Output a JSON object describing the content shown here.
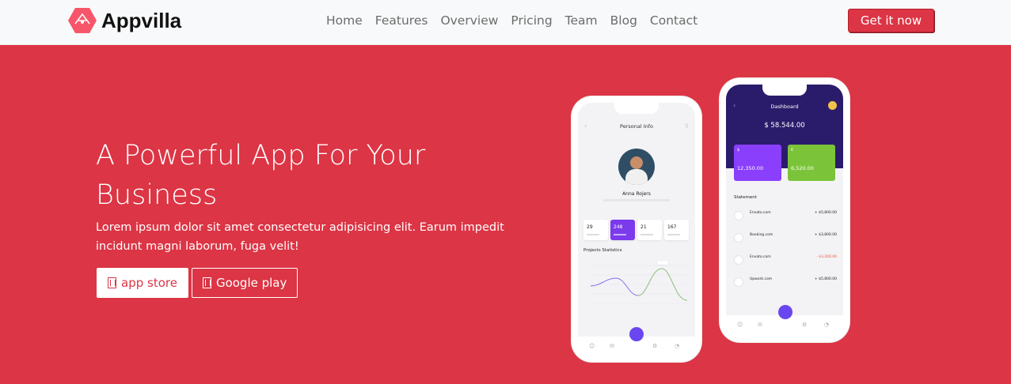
{
  "brand": {
    "name": "Appvilla",
    "logo_color": "#f7566a"
  },
  "nav": {
    "links": [
      "Home",
      "Features",
      "Overview",
      "Pricing",
      "Team",
      "Blog",
      "Contact"
    ],
    "cta": "Get it now"
  },
  "hero": {
    "title": "A Powerful App For Your Business",
    "text": "Lorem ipsum dolor sit amet consectetur adipisicing elit. Earum impedit incidunt magni laborum, fuga velit!",
    "buttons": [
      {
        "label": "app store",
        "icon": "app-store-glyph"
      },
      {
        "label": "Google play",
        "icon": "google-play-glyph"
      }
    ]
  },
  "phone_left": {
    "screen_title": "Personal Info",
    "user_name": "Anna Rojers",
    "stats": [
      {
        "value": "29"
      },
      {
        "value": "248"
      },
      {
        "value": "21"
      },
      {
        "value": "167"
      }
    ],
    "section_title": "Projects Statistics"
  },
  "phone_right": {
    "screen_title": "Dashboard",
    "balance": "$ 58.544.00",
    "cards": [
      {
        "symbol": "$",
        "amount": "12,350.00",
        "color": "#8a3ffc"
      },
      {
        "symbol": "€",
        "amount": "6,520.00",
        "color": "#7bc43a"
      }
    ],
    "statement_title": "Statement",
    "transactions": [
      {
        "name": "Envato.com",
        "amount": "+ $5,800.00",
        "color": "#222222"
      },
      {
        "name": "Booking.com",
        "amount": "+ $3,800.00",
        "color": "#222222"
      },
      {
        "name": "Envato.com",
        "amount": "- $3,200.00",
        "color": "#e5533d"
      },
      {
        "name": "Upwork.com",
        "amount": "+ $5,800.00",
        "color": "#222222"
      }
    ]
  },
  "colors": {
    "hero_bg": "#dc3545",
    "nav_bg": "#f8f9fa",
    "accent": "#6a46f0"
  }
}
